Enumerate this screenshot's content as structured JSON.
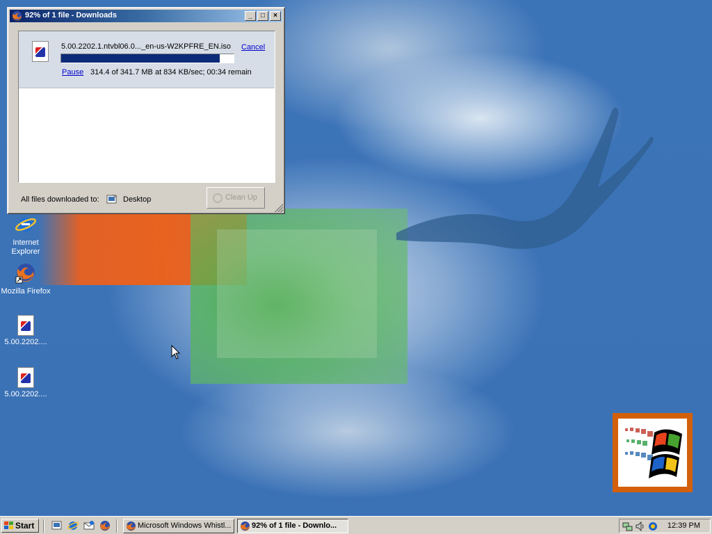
{
  "window": {
    "title": "92% of 1 file - Downloads",
    "minimize": "_",
    "maximize": "□",
    "close": "×"
  },
  "download": {
    "filename": "5.00.2202.1.ntvbl06.0..._en-us-W2KPFRE_EN.iso",
    "cancel_label": "Cancel",
    "pause_label": "Pause",
    "status": "314.4 of 341.7 MB at 834 KB/sec; 00:34 remain",
    "progress_fraction": 0.92
  },
  "footer": {
    "saved_to_label": "All files downloaded to:",
    "destination": "Desktop",
    "cleanup_label": "Clean Up"
  },
  "desktop_icons": [
    {
      "label": "Internet Explorer",
      "icon": "ie-icon"
    },
    {
      "label": "Mozilla Firefox",
      "icon": "firefox-icon"
    },
    {
      "label": "5.00.2202....",
      "icon": "iso-file-icon"
    },
    {
      "label": "5.00.2202....",
      "icon": "iso-file-icon"
    }
  ],
  "taskbar": {
    "start_label": "Start",
    "tasks": [
      {
        "label": "Microsoft Windows Whistl...",
        "active": false
      },
      {
        "label": "92% of 1 file - Downlo...",
        "active": true
      }
    ],
    "clock": "12:39 PM"
  },
  "colors": {
    "title_active": "#0a246a",
    "progress_fill": "#0b2a78",
    "link": "#0000cc",
    "desktop": "#3a70b4"
  }
}
